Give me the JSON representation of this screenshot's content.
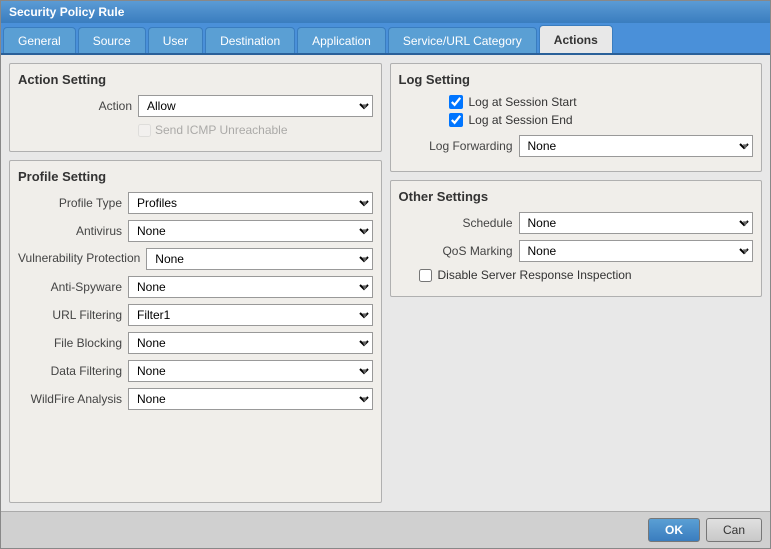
{
  "window": {
    "title": "Security Policy Rule"
  },
  "tabs": [
    {
      "label": "General",
      "active": false
    },
    {
      "label": "Source",
      "active": false
    },
    {
      "label": "User",
      "active": false
    },
    {
      "label": "Destination",
      "active": false
    },
    {
      "label": "Application",
      "active": false
    },
    {
      "label": "Service/URL Category",
      "active": false
    },
    {
      "label": "Actions",
      "active": true
    }
  ],
  "action_setting": {
    "title": "Action Setting",
    "action_label": "Action",
    "action_value": "Allow",
    "send_icmp_label": "Send ICMP Unreachable",
    "send_icmp_disabled": true
  },
  "profile_setting": {
    "title": "Profile Setting",
    "profile_type_label": "Profile Type",
    "profile_type_value": "Profiles",
    "antivirus_label": "Antivirus",
    "antivirus_value": "None",
    "vuln_label": "Vulnerability Protection",
    "vuln_value": "None",
    "anti_spyware_label": "Anti-Spyware",
    "anti_spyware_value": "None",
    "url_filtering_label": "URL Filtering",
    "url_filtering_value": "Filter1",
    "file_blocking_label": "File Blocking",
    "file_blocking_value": "None",
    "data_filtering_label": "Data Filtering",
    "data_filtering_value": "None",
    "wildfire_label": "WildFire Analysis",
    "wildfire_value": "None"
  },
  "log_setting": {
    "title": "Log Setting",
    "log_session_start_label": "Log at Session Start",
    "log_session_start_checked": true,
    "log_session_end_label": "Log at Session End",
    "log_session_end_checked": true,
    "log_forwarding_label": "Log Forwarding",
    "log_forwarding_value": "None"
  },
  "other_settings": {
    "title": "Other Settings",
    "schedule_label": "Schedule",
    "schedule_value": "None",
    "qos_label": "QoS Marking",
    "qos_value": "None",
    "disable_server_label": "Disable Server Response Inspection"
  },
  "footer": {
    "ok_label": "OK",
    "cancel_label": "Can"
  }
}
